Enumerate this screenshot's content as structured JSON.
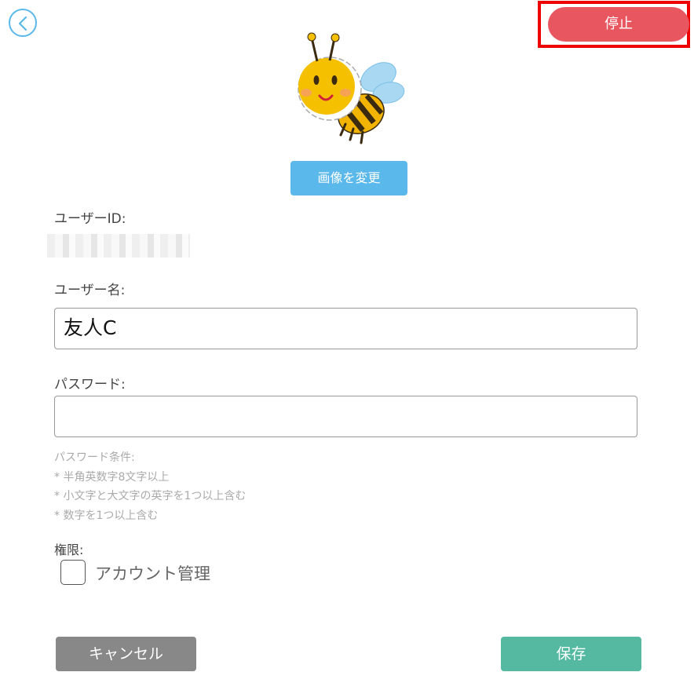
{
  "header": {
    "back_icon": "chevron-left-icon",
    "stop_label": "停止"
  },
  "avatar": {
    "image": "bee-illustration",
    "change_label": "画像を変更"
  },
  "form": {
    "userid_label": "ユーザーID:",
    "username_label": "ユーザー名:",
    "username_value": "友人C",
    "password_label": "パスワード:",
    "password_value": "",
    "password_hint": {
      "title": "パスワード条件:",
      "rules": [
        "* 半角英数字8文字以上",
        "* 小文字と大文字の英字を1つ以上含む",
        "* 数字を1つ以上含む"
      ]
    },
    "permission_label": "権限:",
    "permission_option": "アカウント管理",
    "permission_checked": false
  },
  "footer": {
    "cancel_label": "キャンセル",
    "save_label": "保存"
  },
  "colors": {
    "stop": "#e85660",
    "change_image": "#5bb8ea",
    "cancel": "#888888",
    "save": "#54b9a0",
    "highlight": "#ee0000"
  }
}
